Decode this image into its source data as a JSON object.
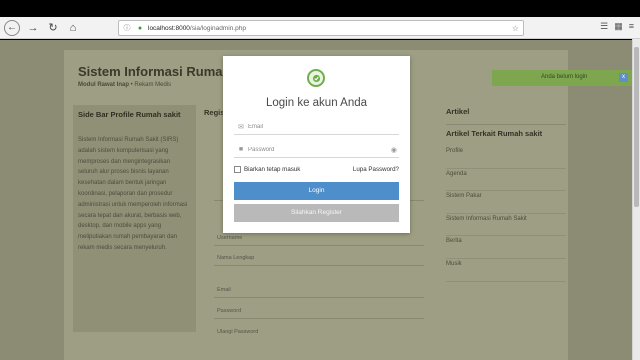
{
  "browser": {
    "url_host": "localhost:8000",
    "url_path": "/sia/loginadmin.php",
    "reader_icon": "reader-icon",
    "bookmark_icon": "star-icon"
  },
  "site": {
    "title": "Sistem Informasi Rumah Sakit",
    "subtitle_bold": "Modul Rawat Inap",
    "subtitle_rest": " • Rekam Medis"
  },
  "sidebar": {
    "heading": "Side Bar Profile Rumah sakit",
    "body": "Sistem Informasi Rumah Sakit (SIRS) adalah sistem komputerisasi yang memproses dan mengintegrasikan seluruh alur proses bisnis layanan kesehatan dalam bentuk jaringan koordinasi, pelaporan dan prosedur administrasi untuk memperoleh informasi secara tepat dan akurat, berbasis web, desktop, dan mobile apps yang meliputiakan rumah pembayaran dan rekam medis secara menyeluruh."
  },
  "register_bg": {
    "heading": "Registrasi",
    "labels": [
      "Username",
      "Nama Lengkap",
      "Email",
      "Password",
      "Ulangi Password"
    ]
  },
  "article": {
    "heading": "Artikel",
    "subheading": "Artikel Terkait Rumah sakit",
    "links": [
      "Profile",
      "Agenda",
      "Sistem Pakar",
      "Sistem Informasi Rumah Sakit",
      "Berita",
      "Musik"
    ]
  },
  "toast": {
    "message": "Anda belum login",
    "close": "x"
  },
  "modal": {
    "title": "Login ke akun Anda",
    "email_placeholder": "Email",
    "password_placeholder": "Password",
    "remember_label": "Biarkan tetap masuk",
    "forgot_label": "Lupa Password?",
    "login_label": "Login",
    "register_label": "Silahkan Register"
  },
  "colors": {
    "login_button": "#4e8fcb",
    "register_button": "#b9b9b9",
    "toast_bg": "#7ea64f",
    "overlay_page": "#9d9e83"
  }
}
